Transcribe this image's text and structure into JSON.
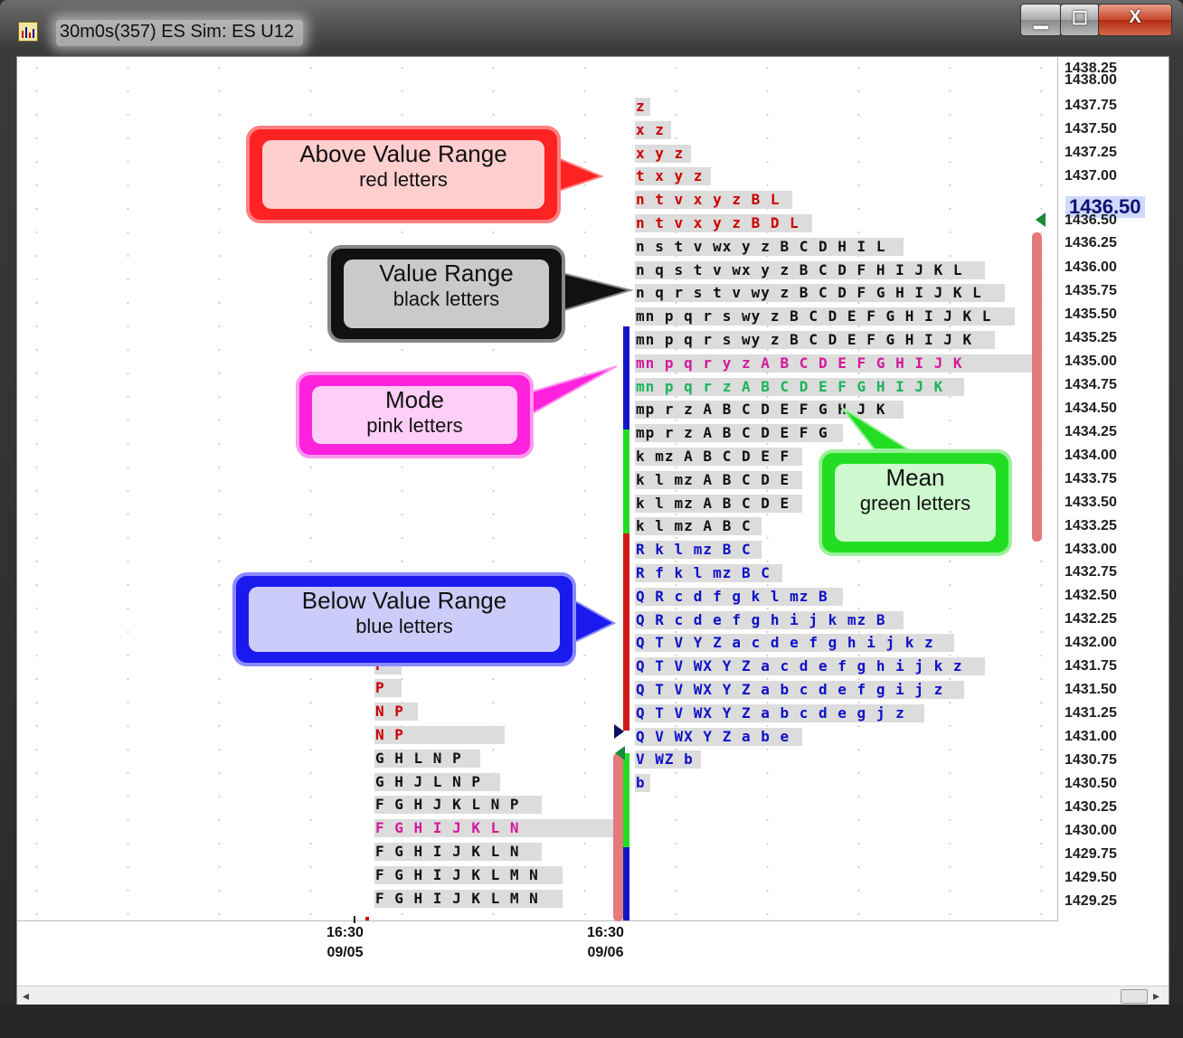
{
  "window": {
    "title": "30m0s(357) ES Sim: ES U12",
    "controls": {
      "minimize": "▁",
      "maximize": "☐",
      "close": "X"
    }
  },
  "price_axis": {
    "prices": [
      "1438.25",
      "1438.00",
      "1437.75",
      "1437.50",
      "1437.25",
      "1437.00",
      "1436.50",
      "1436.25",
      "1436.00",
      "1435.75",
      "1435.50",
      "1435.25",
      "1435.00",
      "1434.75",
      "1434.50",
      "1434.25",
      "1434.00",
      "1433.75",
      "1433.50",
      "1433.25",
      "1433.00",
      "1432.75",
      "1432.50",
      "1432.25",
      "1432.00",
      "1431.75",
      "1431.50",
      "1431.25",
      "1431.00",
      "1430.75",
      "1430.50",
      "1430.25",
      "1430.00",
      "1429.75",
      "1429.50",
      "1429.25"
    ],
    "current_price": "1436.50"
  },
  "time_axis": {
    "labels": [
      {
        "time": "16:30",
        "date": "09/05"
      },
      {
        "time": "16:30",
        "date": "09/06"
      }
    ]
  },
  "colors": {
    "above": "#cc0000",
    "value": "#111111",
    "mode": "#d2199a",
    "mean": "#1ab55a",
    "below": "#1010c8"
  },
  "profile_1": [
    {
      "text": "P",
      "cls": "above"
    },
    {
      "text": "P",
      "cls": "above"
    },
    {
      "text": "N P",
      "cls": "above"
    },
    {
      "text": "N P",
      "cls": "above"
    },
    {
      "text": "G H L N P",
      "cls": "value"
    },
    {
      "text": "G H J L N P",
      "cls": "value"
    },
    {
      "text": "F G H J K L N P",
      "cls": "value"
    },
    {
      "text": "F G H I J K L N",
      "cls": "mode"
    },
    {
      "text": "F G H I J K L N",
      "cls": "value"
    },
    {
      "text": "F G H I J K L M N",
      "cls": "value"
    },
    {
      "text": "F G H I J K L M N",
      "cls": "value"
    }
  ],
  "profile_2": [
    {
      "text": "z",
      "cls": "above"
    },
    {
      "text": "x z",
      "cls": "above"
    },
    {
      "text": "x y z",
      "cls": "above"
    },
    {
      "text": "t x y z",
      "cls": "above"
    },
    {
      "text": "n t v x y z B L",
      "cls": "above"
    },
    {
      "text": "n t v x y z B D L",
      "cls": "above"
    },
    {
      "text": "n s t v wx y z B C D H I L",
      "cls": "value"
    },
    {
      "text": "n q s t v wx y z B C D F H I J K L",
      "cls": "value"
    },
    {
      "text": "n q r s t v wy z B C D F G H I J K L",
      "cls": "value"
    },
    {
      "text": "mn p q r s wy z B C D E F G H I J K L",
      "cls": "value"
    },
    {
      "text": "mn p q r s wy z B C D E F G H I J K",
      "cls": "value"
    },
    {
      "text": "mn p q r y z A B C D E F G H I J K",
      "cls": "mode"
    },
    {
      "text": "mn p q r z A B C D E F G H I J K",
      "cls": "mean"
    },
    {
      "text": "mp r z A B C D E F G H J K",
      "cls": "value"
    },
    {
      "text": "mp r z A B C D E F G",
      "cls": "value"
    },
    {
      "text": "k mz A B C D E F",
      "cls": "value"
    },
    {
      "text": "k l mz A B C D E",
      "cls": "value"
    },
    {
      "text": "k l mz A B C D E",
      "cls": "value"
    },
    {
      "text": "k l mz A B C",
      "cls": "value"
    },
    {
      "text": "R k l mz B C",
      "cls": "below"
    },
    {
      "text": "R f k l mz B C",
      "cls": "below"
    },
    {
      "text": "Q R c d f g k l mz B",
      "cls": "below"
    },
    {
      "text": "Q R c d e f g h i j k mz B",
      "cls": "below"
    },
    {
      "text": "Q T V Y Z a c d e f g h i j k z",
      "cls": "below"
    },
    {
      "text": "Q T V WX Y Z a c d e f g h i j k z",
      "cls": "below"
    },
    {
      "text": "Q T V WX Y Z a b c d e f g i j z",
      "cls": "below"
    },
    {
      "text": "Q T V WX Y Z a b c d e g j z",
      "cls": "below"
    },
    {
      "text": "Q V WX Y Z a b e",
      "cls": "below"
    },
    {
      "text": "V WZ b",
      "cls": "below"
    },
    {
      "text": "b",
      "cls": "below"
    }
  ],
  "callouts": {
    "above": {
      "title": "Above Value Range",
      "subtitle": "red letters"
    },
    "value": {
      "title": "Value Range",
      "subtitle": "black letters"
    },
    "mode": {
      "title": "Mode",
      "subtitle": "pink letters"
    },
    "mean": {
      "title": "Mean",
      "subtitle": "green letters"
    },
    "below": {
      "title": "Below Value Range",
      "subtitle": "blue letters"
    }
  }
}
